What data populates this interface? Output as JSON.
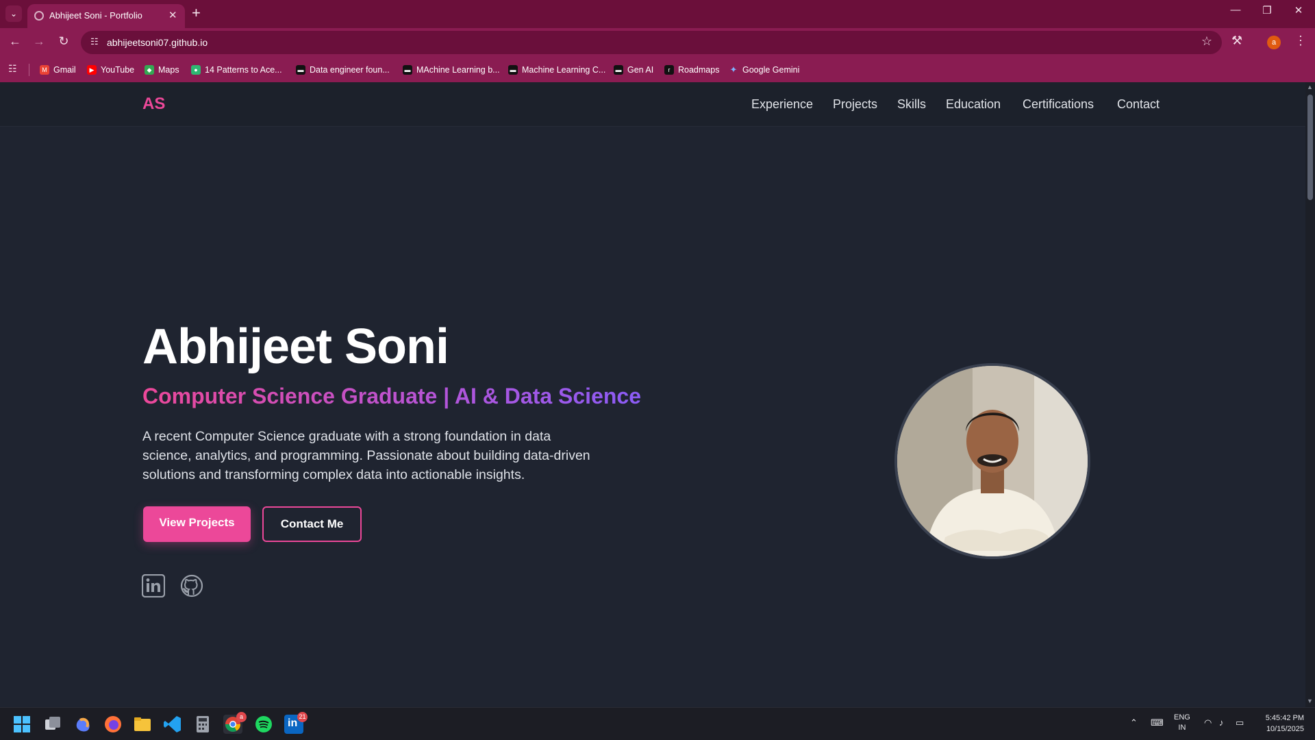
{
  "browser": {
    "tab_title": "Abhijeet Soni - Portfolio",
    "url": "abhijeetsoni07.github.io",
    "profile_initial": "a",
    "bookmarks": [
      {
        "label": "Gmail",
        "color": "#ea4335"
      },
      {
        "label": "YouTube",
        "color": "#ff0000"
      },
      {
        "label": "Maps",
        "color": "#34a853"
      },
      {
        "label": "14 Patterns to Ace...",
        "color": "#2eb872"
      },
      {
        "label": "Data engineer foun...",
        "color": "#111111"
      },
      {
        "label": "MAchine Learning b...",
        "color": "#111111"
      },
      {
        "label": "Machine Learning C...",
        "color": "#111111"
      },
      {
        "label": "Gen AI",
        "color": "#111111"
      },
      {
        "label": "Roadmaps",
        "color": "#111111"
      },
      {
        "label": "Google Gemini",
        "color": "#4b8bf5"
      }
    ]
  },
  "site": {
    "logo": "AS",
    "nav": [
      "Experience",
      "Projects",
      "Skills",
      "Education",
      "Certifications",
      "Contact"
    ],
    "hero": {
      "name": "Abhijeet Soni",
      "subtitle": "Computer Science Graduate | AI & Data Science",
      "description": "A recent Computer Science graduate with a strong foundation in data science, analytics, and programming. Passionate about building data-driven solutions and transforming complex data into actionable insights.",
      "primary_button": "View Projects",
      "secondary_button": "Contact Me"
    },
    "accent_color": "#ec4899",
    "background_color": "#1f2430"
  },
  "taskbar": {
    "chrome_badge": "a",
    "linkedin_badge": "21",
    "lang_top": "ENG",
    "lang_bottom": "IN",
    "time": "5:45:42 PM",
    "date": "10/15/2025"
  }
}
